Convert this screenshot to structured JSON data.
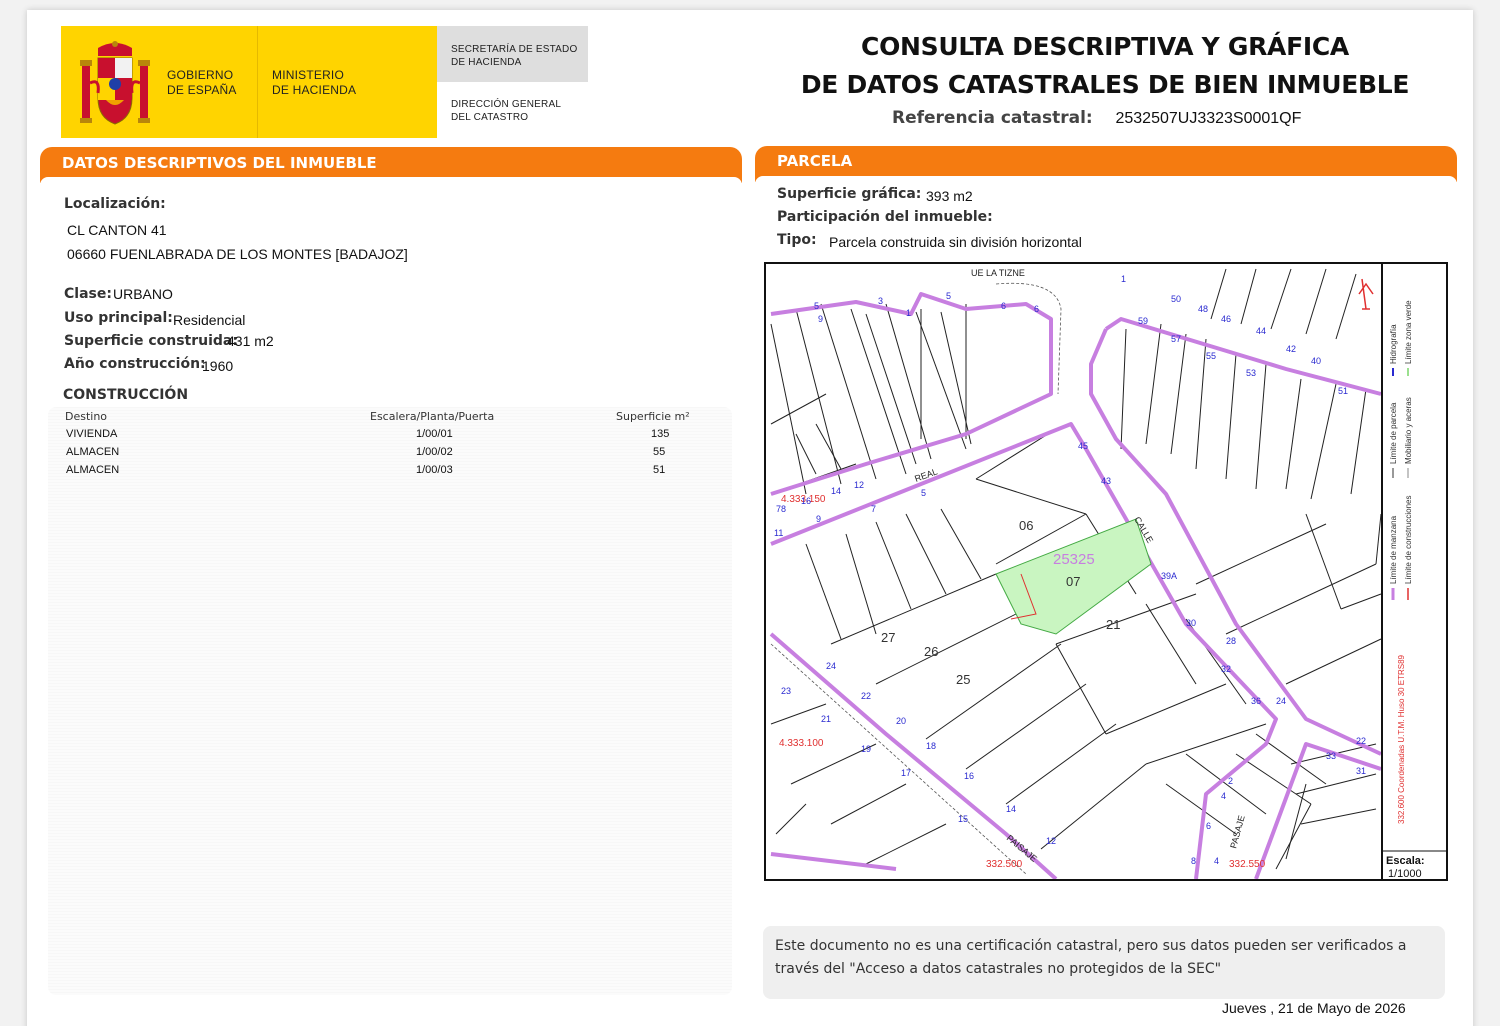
{
  "header": {
    "gov_line1": "GOBIERNO",
    "gov_line2": "DE ESPAÑA",
    "min_line1": "MINISTERIO",
    "min_line2": "DE HACIENDA",
    "sec_line1": "SECRETARÍA DE ESTADO",
    "sec_line2": "DE HACIENDA",
    "dir_line1": "DIRECCIÓN GENERAL",
    "dir_line2": "DEL CATASTRO",
    "title_line1": "CONSULTA DESCRIPTIVA Y GRÁFICA",
    "title_line2": "DE DATOS CATASTRALES DE BIEN INMUEBLE",
    "ref_label": "Referencia catastral:",
    "ref_value": "2532507UJ3323S0001QF"
  },
  "descriptivos": {
    "section_title": "DATOS DESCRIPTIVOS DEL INMUEBLE",
    "localizacion_label": "Localización:",
    "address_line1": "CL CANTON 41",
    "address_line2": "06660 FUENLABRADA DE LOS MONTES [BADAJOZ]",
    "clase_label": "Clase:",
    "clase_value": "URBANO",
    "uso_label": "Uso principal:",
    "uso_value": "Residencial",
    "superficie_label": "Superficie construida:",
    "superficie_value": "431 m2",
    "anio_label": "Año construcción:",
    "anio_value": "1960",
    "construccion_title": "CONSTRUCCIÓN",
    "table_headers": {
      "destino": "Destino",
      "escalera": "Escalera/Planta/Puerta",
      "superficie": "Superficie m²"
    },
    "rows": [
      {
        "destino": "VIVIENDA",
        "escalera": "1/00/01",
        "superficie": "135"
      },
      {
        "destino": "ALMACEN",
        "escalera": "1/00/02",
        "superficie": "55"
      },
      {
        "destino": "ALMACEN",
        "escalera": "1/00/03",
        "superficie": "51"
      }
    ]
  },
  "parcela": {
    "section_title": "PARCELA",
    "sup_grafica_label": "Superficie gráfica:",
    "sup_grafica_value": "393 m2",
    "participacion_label": "Participación del inmueble:",
    "tipo_label": "Tipo:",
    "tipo_value": "Parcela construida sin división horizontal"
  },
  "map": {
    "street_top": "UE LA TIZNE",
    "street_real": "REAL",
    "street_calle": "CALLE",
    "street_paisaje": "PAISAJE",
    "street_pasaje": "PASAJE",
    "manzana": "25325",
    "parcela_num": "07",
    "coord_y1": "4.333.150",
    "coord_y2": "4.333.100",
    "coord_x1": "332.500",
    "coord_x2": "332.550",
    "plot_labels": [
      "06",
      "27",
      "26",
      "25",
      "21"
    ],
    "legend_hidrografia": "Hidrografía",
    "legend_zona_verde": "Límite zona verde",
    "legend_parcela": "Límite de parcela",
    "legend_mobiliario": "Mobiliario y aceras",
    "legend_manzana": "Límite de manzana",
    "legend_construcciones": "Límite de construcciones",
    "coords_note": "332.600 Coordenadas U.T.M. Huso 30 ETRS89",
    "escala_label": "Escala:",
    "escala_value": "1/1000",
    "colors": {
      "manzana": "#c77fe0",
      "parcela_fill": "#c9f5c1",
      "coord": "#e03030",
      "number": "#2a2ad0"
    }
  },
  "footer": {
    "note": "Este documento no es una certificación catastral, pero sus datos pueden ser verificados a través del \"Acceso a datos catastrales no protegidos de la SEC\"",
    "date": "Jueves , 21 de Mayo de 2026"
  }
}
